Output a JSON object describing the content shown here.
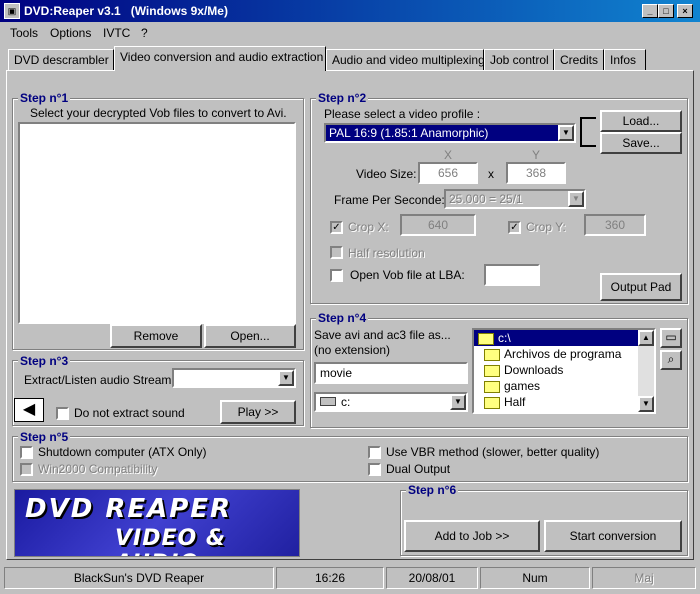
{
  "window": {
    "title": "DVD:Reaper v3.1   (Windows 9x/Me)"
  },
  "menu": [
    "Tools",
    "Options",
    "IVTC",
    "?"
  ],
  "tabs": [
    "DVD descrambler",
    "Video conversion and audio extraction",
    "Audio and video multiplexing",
    "Job control",
    "Credits",
    "Infos"
  ],
  "step1": {
    "label": "Step n°1",
    "hint": "Select your  decrypted Vob files to convert to Avi.",
    "remove": "Remove",
    "open": "Open..."
  },
  "step2": {
    "label": "Step n°2",
    "profile_label": "Please select a video profile :",
    "profile_value": "PAL 16:9 (1.85:1 Anamorphic)",
    "load": "Load...",
    "save": "Save...",
    "x_label": "X",
    "y_label": "Y",
    "video_size_label": "Video Size:",
    "width": "656",
    "times": "x",
    "height": "368",
    "fps_label": "Frame Per Seconde:",
    "fps_value": "25.000 = 25/1",
    "crop_x_label": "Crop X:",
    "crop_x": "640",
    "crop_y_label": "Crop Y:",
    "crop_y": "360",
    "half_res": "Half resolution",
    "open_vob": "Open Vob file at LBA:",
    "lba": "",
    "output_pad": "Output Pad"
  },
  "step3": {
    "label": "Step n°3",
    "extract_label": "Extract/Listen audio Stream",
    "stream_value": "",
    "no_extract": "Do not extract sound",
    "play": "Play >>"
  },
  "step4": {
    "label": "Step n°4",
    "save_label": "Save avi and ac3 file as... (no extension)",
    "filename": "movie",
    "drive": "c:",
    "folders": [
      "c:\\",
      "Archivos de programa",
      "Downloads",
      "games",
      "Half"
    ]
  },
  "step5": {
    "label": "Step n°5",
    "shutdown": "Shutdown computer (ATX Only)",
    "win2000": "Win2000 Compatibility",
    "vbr": "Use VBR method (slower, better quality)",
    "dual": "Dual Output"
  },
  "logo": {
    "line1": "DVD REAPER",
    "line2": "VIDEO & AUDIO"
  },
  "step6": {
    "label": "Step n°6",
    "add_job": "Add to Job >>",
    "start": "Start conversion"
  },
  "status": {
    "app": "BlackSun's DVD Reaper",
    "time": "16:26",
    "date": "20/08/01",
    "num": "Num",
    "maj": "Maj"
  }
}
